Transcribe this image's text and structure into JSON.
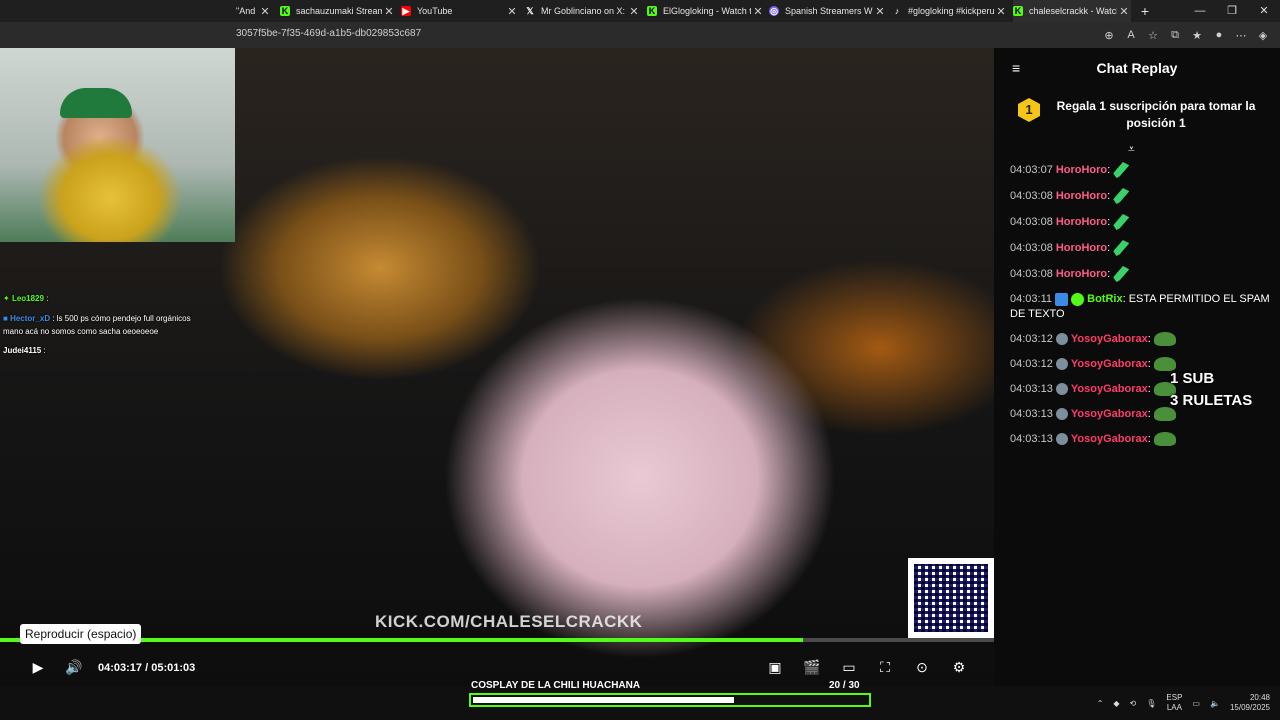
{
  "tabs": [
    {
      "label": "\"And",
      "color": "#ffffff"
    },
    {
      "label": "sachauzumaki Stream",
      "color": "#53fc18"
    },
    {
      "label": "YouTube",
      "color": "#ff0000"
    },
    {
      "label": "Mr Goblinciano on X: \"",
      "color": "#ffffff"
    },
    {
      "label": "ElGlogloking - Watch t",
      "color": "#53fc18"
    },
    {
      "label": "Spanish Streamers With",
      "color": "#7b61ff"
    },
    {
      "label": "#glogloking #kickperu",
      "color": "#ffffff"
    },
    {
      "label": "chaleselcrackk - Watch",
      "color": "#53fc18"
    }
  ],
  "browser": {
    "url": "3057f5be-7f35-469d-a1b5-db029853c687",
    "new_tab": "+"
  },
  "stream": {
    "cam_chat": [
      {
        "user": "Leo1829",
        "text": ":"
      },
      {
        "user": "Hector_xD",
        "text": ": ls 500 ps cómo pendejo full orgánicos"
      },
      {
        "user": "",
        "text": "mano acá no somos como sacha oeoeoeoe"
      },
      {
        "user": "Judei4115",
        "text": ":"
      }
    ],
    "watermark": "KICK.COM/CHALESELCRACKK",
    "overlay_sub": "1 SUB",
    "overlay_ruletas": "3 RULETAS"
  },
  "player": {
    "tooltip": "Reproducir (espacio)",
    "current_time": "04:03:17",
    "separator": "/",
    "duration": "05:01:03",
    "progress": 0.808
  },
  "goal": {
    "title": "COSPLAY DE LA CHILI HUACHANA",
    "count": "20",
    "total": "/ 30",
    "fraction": 0.667
  },
  "chat": {
    "title": "Chat Replay",
    "pinned_rank": "1",
    "pinned_text": "Regala 1 suscripción para tomar la posición 1",
    "messages": [
      {
        "ts": "04:03:07",
        "user": "HoroHoro",
        "color": "#ff5c8a",
        "text": "",
        "emote": "leaf"
      },
      {
        "ts": "04:03:08",
        "user": "HoroHoro",
        "color": "#ff5c8a",
        "text": "",
        "emote": "leaf"
      },
      {
        "ts": "04:03:08",
        "user": "HoroHoro",
        "color": "#ff5c8a",
        "text": "",
        "emote": "leaf"
      },
      {
        "ts": "04:03:08",
        "user": "HoroHoro",
        "color": "#ff5c8a",
        "text": "",
        "emote": "leaf"
      },
      {
        "ts": "04:03:08",
        "user": "HoroHoro",
        "color": "#ff5c8a",
        "text": "",
        "emote": "leaf"
      },
      {
        "ts": "04:03:11",
        "user": "BotRix",
        "color": "#53fc18",
        "text": "ESTA PERMITIDO EL SPAM DE TEXTO",
        "emote": ""
      },
      {
        "ts": "04:03:12",
        "user": "YosoyGaborax",
        "color": "#ff3b6b",
        "text": "",
        "emote": "frog"
      },
      {
        "ts": "04:03:12",
        "user": "YosoyGaborax",
        "color": "#ff3b6b",
        "text": "",
        "emote": "frog"
      },
      {
        "ts": "04:03:13",
        "user": "YosoyGaborax",
        "color": "#ff3b6b",
        "text": "",
        "emote": "frog"
      },
      {
        "ts": "04:03:13",
        "user": "YosoyGaborax",
        "color": "#ff3b6b",
        "text": "",
        "emote": "frog"
      },
      {
        "ts": "04:03:13",
        "user": "YosoyGaborax",
        "color": "#ff3b6b",
        "text": "",
        "emote": "frog"
      }
    ]
  },
  "taskbar": {
    "lang_top": "ESP",
    "lang_bottom": "LAA",
    "time": "20:48",
    "date": "15/09/2025"
  },
  "colors": {
    "accent": "#53fc18"
  }
}
